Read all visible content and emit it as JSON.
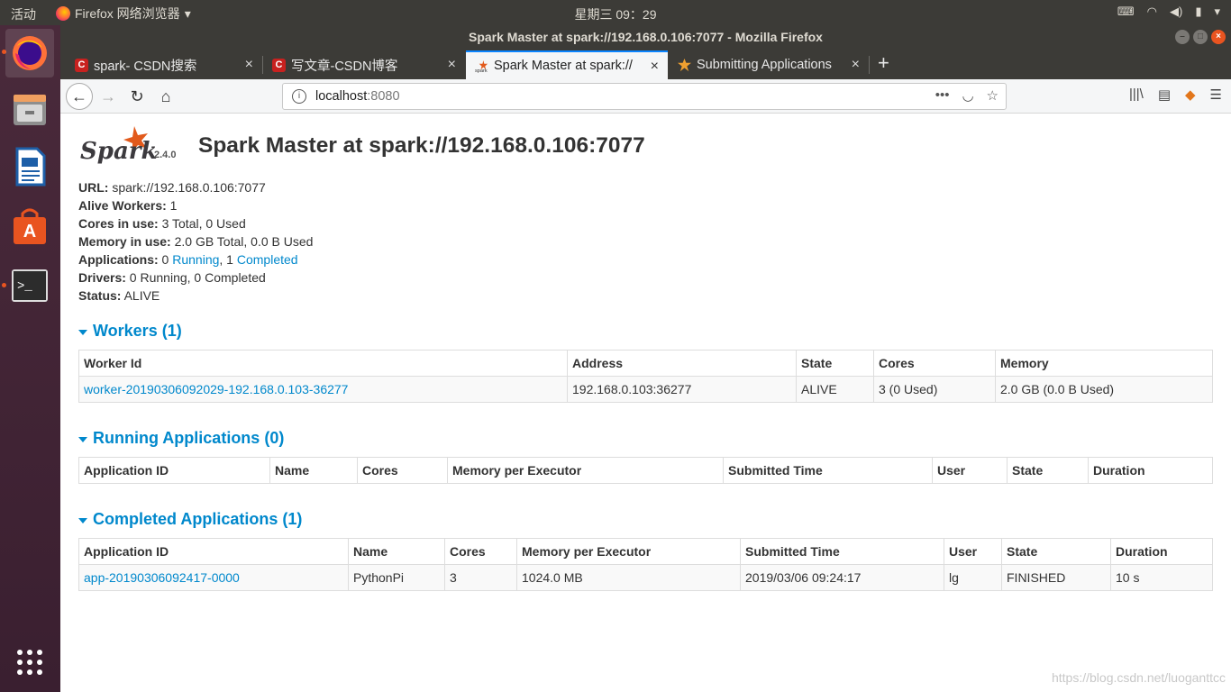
{
  "topbar": {
    "activities": "活动",
    "app_name": "Firefox 网络浏览器",
    "clock": "星期三 09：29"
  },
  "window": {
    "title": "Spark Master at spark://192.168.0.106:7077 - Mozilla Firefox"
  },
  "tabs": [
    {
      "label": "spark- CSDN搜索"
    },
    {
      "label": "写文章-CSDN博客"
    },
    {
      "label": "Spark Master at spark://"
    },
    {
      "label": "Submitting Applications"
    }
  ],
  "url": {
    "host": "localhost",
    "port": ":8080"
  },
  "page": {
    "version": "2.4.0",
    "title": "Spark Master at spark://192.168.0.106:7077",
    "summary": {
      "url_label": "URL:",
      "url_value": " spark://192.168.0.106:7077",
      "workers_label": "Alive Workers:",
      "workers_value": " 1",
      "cores_label": "Cores in use:",
      "cores_value": " 3 Total, 0 Used",
      "memory_label": "Memory in use:",
      "memory_value": " 2.0 GB Total, 0.0 B Used",
      "apps_label": "Applications:",
      "apps_running_count": " 0 ",
      "apps_running": "Running",
      "apps_sep": ", 1 ",
      "apps_completed": "Completed",
      "drivers_label": "Drivers:",
      "drivers_value": " 0 Running, 0 Completed",
      "status_label": "Status:",
      "status_value": " ALIVE"
    },
    "workers": {
      "heading": "Workers (1)",
      "headers": [
        "Worker Id",
        "Address",
        "State",
        "Cores",
        "Memory"
      ],
      "rows": [
        [
          "worker-20190306092029-192.168.0.103-36277",
          "192.168.0.103:36277",
          "ALIVE",
          "3 (0 Used)",
          "2.0 GB (0.0 B Used)"
        ]
      ]
    },
    "running": {
      "heading": "Running Applications (0)",
      "headers": [
        "Application ID",
        "Name",
        "Cores",
        "Memory per Executor",
        "Submitted Time",
        "User",
        "State",
        "Duration"
      ]
    },
    "completed": {
      "heading": "Completed Applications (1)",
      "headers": [
        "Application ID",
        "Name",
        "Cores",
        "Memory per Executor",
        "Submitted Time",
        "User",
        "State",
        "Duration"
      ],
      "rows": [
        [
          "app-20190306092417-0000",
          "PythonPi",
          "3",
          "1024.0 MB",
          "2019/03/06 09:24:17",
          "lg",
          "FINISHED",
          "10 s"
        ]
      ]
    },
    "watermark": "https://blog.csdn.net/luoganttcc"
  }
}
